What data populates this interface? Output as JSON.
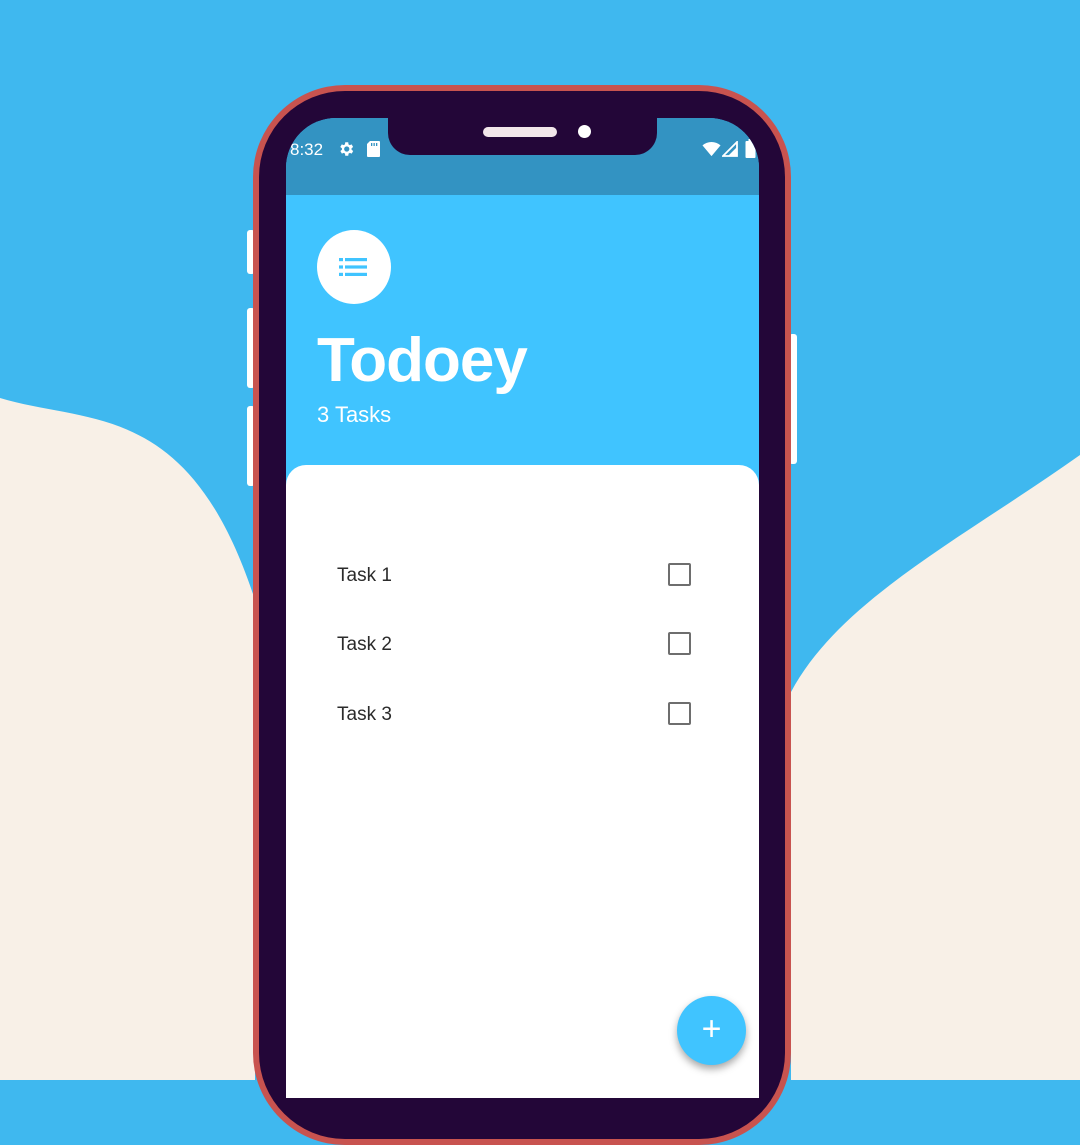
{
  "status_bar": {
    "time": "8:32",
    "left_icons": [
      "settings-icon",
      "sd-card-icon"
    ],
    "right_icons": [
      "wifi-icon",
      "signal-icon",
      "battery-icon"
    ]
  },
  "app": {
    "icon": "list-icon",
    "title": "Todoey",
    "task_count": "3 Tasks"
  },
  "tasks": [
    {
      "label": "Task 1",
      "checked": false
    },
    {
      "label": "Task 2",
      "checked": false
    },
    {
      "label": "Task 3",
      "checked": false
    }
  ],
  "fab": {
    "label": "+",
    "icon": "plus-icon"
  },
  "colors": {
    "background": "#3fb8ef",
    "wave": "#f8f0e7",
    "phone_bezel": "#230638",
    "phone_rim": "#c8534f",
    "status_bar": "#3393c2",
    "accent": "#40c4ff"
  }
}
